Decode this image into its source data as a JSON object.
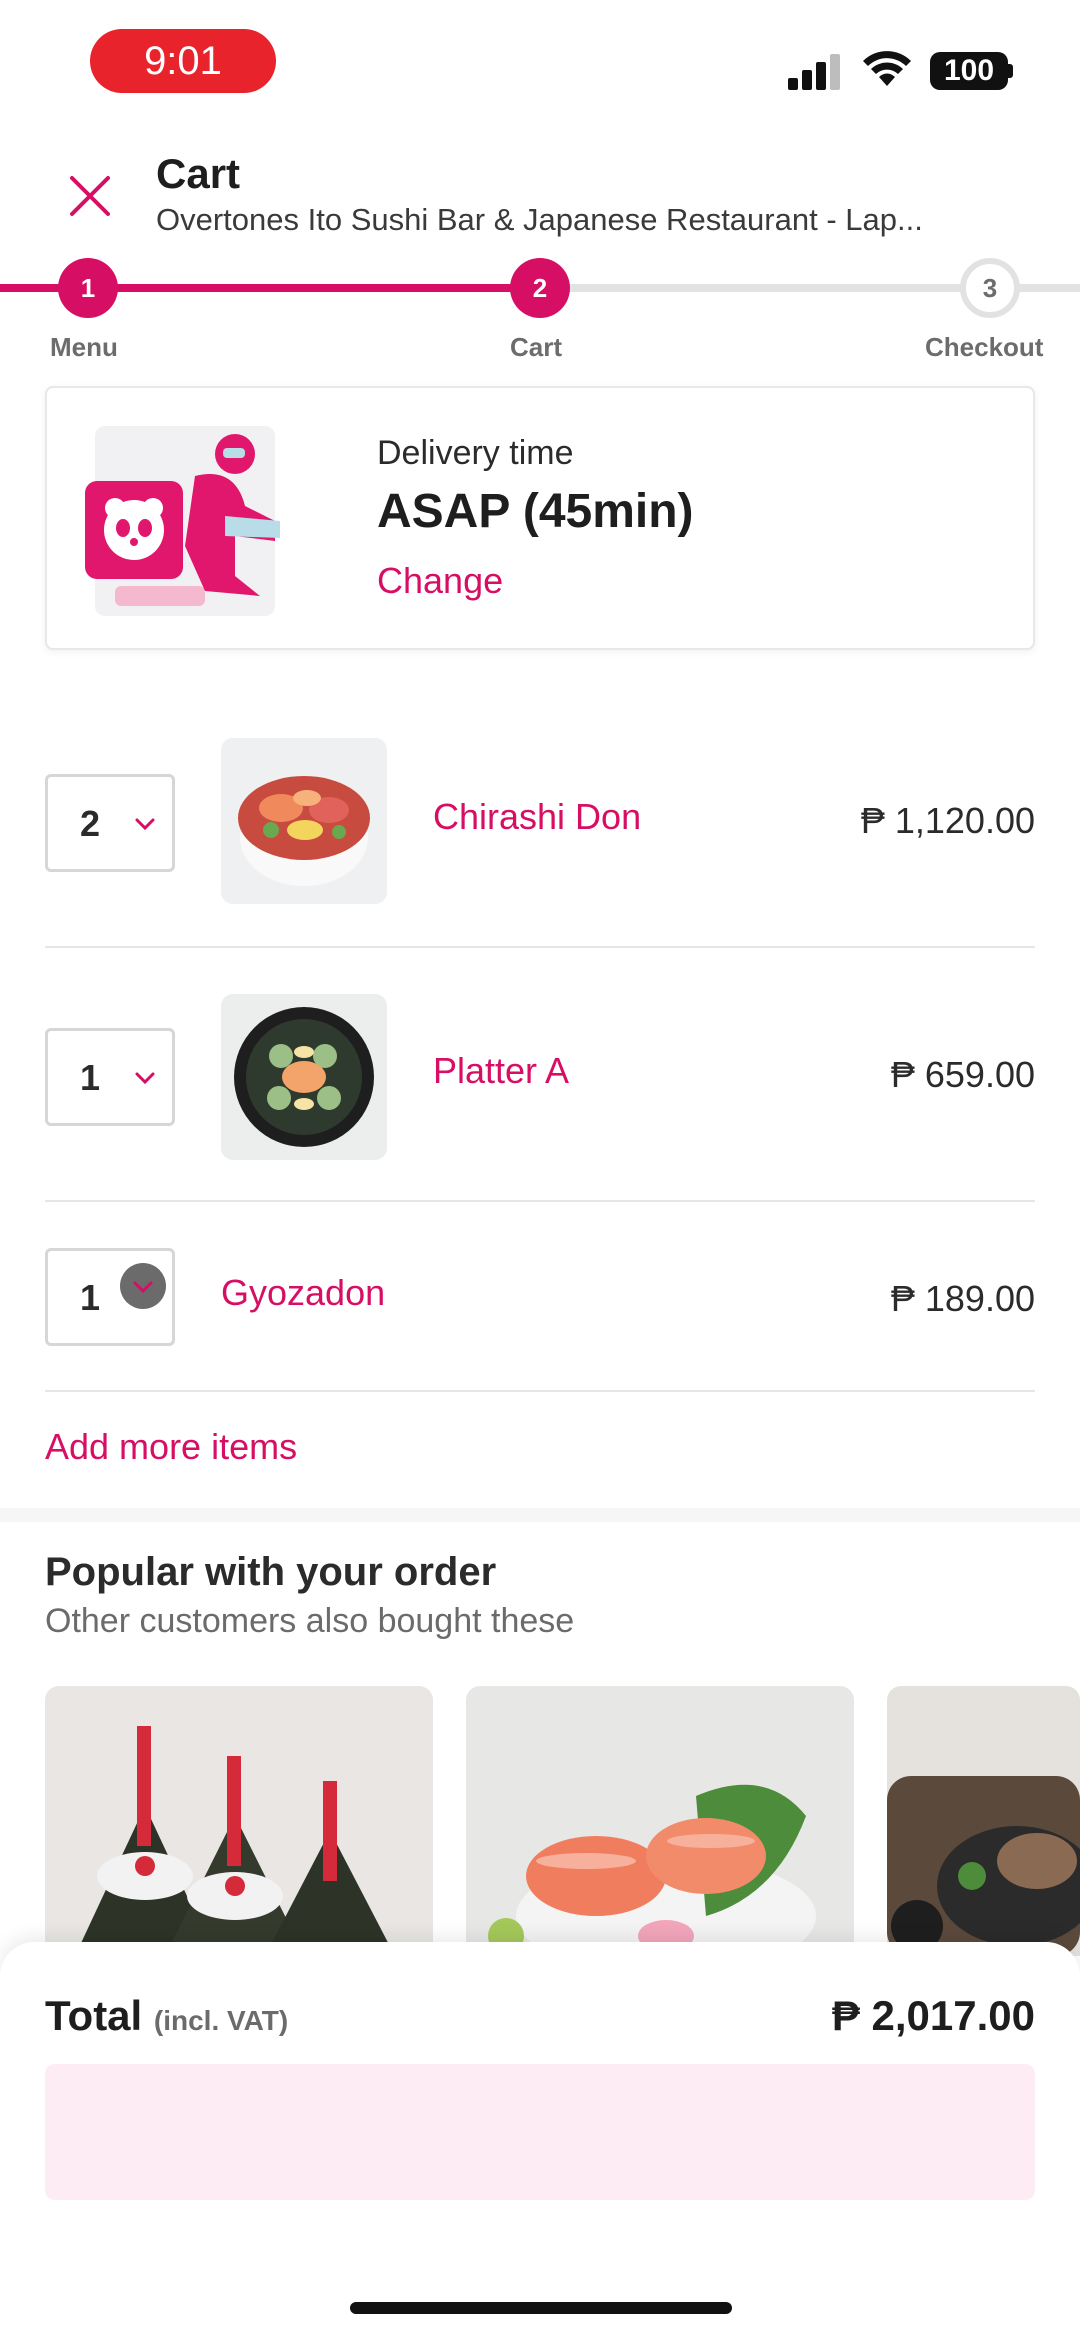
{
  "status_bar": {
    "time": "9:01",
    "battery": "100"
  },
  "header": {
    "title": "Cart",
    "restaurant": "Overtones Ito Sushi Bar & Japanese Restaurant - Lap..."
  },
  "stepper": {
    "steps": [
      {
        "number": "1",
        "label": "Menu"
      },
      {
        "number": "2",
        "label": "Cart"
      },
      {
        "number": "3",
        "label": "Checkout"
      }
    ]
  },
  "delivery": {
    "label": "Delivery time",
    "value": "ASAP (45min)",
    "change": "Change"
  },
  "cart": {
    "items": [
      {
        "qty": "2",
        "name": "Chirashi Don",
        "price": "₱ 1,120.00"
      },
      {
        "qty": "1",
        "name": "Platter A",
        "price": "₱ 659.00"
      },
      {
        "qty": "1",
        "name": "Gyozadon",
        "price": "₱ 189.00"
      }
    ],
    "add_more": "Add more items"
  },
  "popular": {
    "title": "Popular with your order",
    "subtitle": "Other customers also bought these"
  },
  "total": {
    "label": "Total",
    "vat": "(incl. VAT)",
    "value": "₱ 2,017.00"
  },
  "colors": {
    "brand": "#d70f64",
    "status_pill": "#e8232b",
    "track_inactive": "#e2e2e2",
    "cta_disabled": "#fdecf4"
  }
}
